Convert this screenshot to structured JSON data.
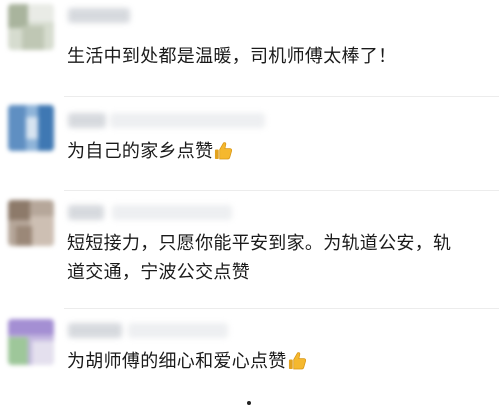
{
  "comments": [
    {
      "text": "生活中到处都是温暖，司机师傅太棒了！",
      "emoji": ""
    },
    {
      "text": "为自己的家乡点赞",
      "emoji": "thumbs-up-icon"
    },
    {
      "text_line1": "短短接力，只愿你能平安到家。为轨道公安，轨",
      "text_line2": "道交通，宁波公交点赞",
      "emoji": ""
    },
    {
      "text": "为胡师傅的细心和爱心点赞",
      "emoji": "thumbs-up-icon"
    }
  ],
  "colors": {
    "text": "#1a1a1a",
    "background": "#ffffff",
    "thumb": "#f5b82e"
  }
}
